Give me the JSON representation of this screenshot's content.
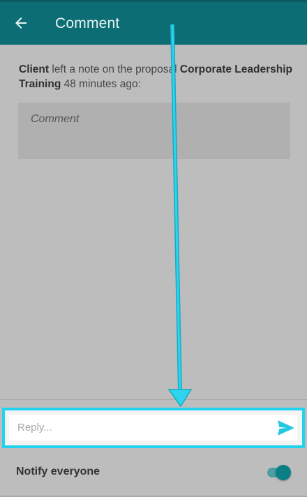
{
  "header": {
    "title": "Comment",
    "back_icon": "arrow-left-icon",
    "color": "#0d6d74"
  },
  "note": {
    "author": "Client",
    "mid_text": " left a note on the proposal ",
    "proposal": "Corporate Leadership Training",
    "time_text": " 48 minutes ago:"
  },
  "comment": {
    "placeholder": "Comment"
  },
  "reply": {
    "placeholder": "Reply...",
    "value": "",
    "send_icon": "send-icon",
    "highlight_color": "#22d2ee"
  },
  "notify": {
    "label": "Notify everyone",
    "enabled": true
  }
}
